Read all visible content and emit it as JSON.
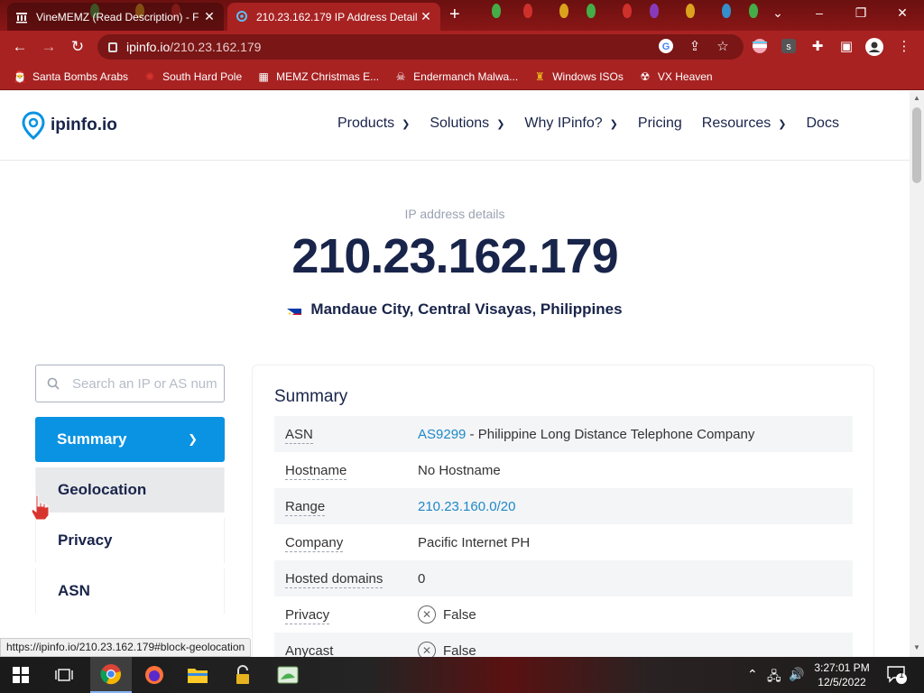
{
  "browser": {
    "tabs": [
      {
        "title": "VineMEMZ (Read Description) - F",
        "active": false
      },
      {
        "title": "210.23.162.179 IP Address Detail",
        "active": true
      }
    ],
    "url_domain": "ipinfo.io",
    "url_path": "/210.23.162.179",
    "bookmarks": [
      {
        "label": "Santa Bombs Arabs",
        "icon": "santa-icon"
      },
      {
        "label": "South Hard Pole",
        "icon": "flower-icon"
      },
      {
        "label": "MEMZ Christmas E...",
        "icon": "image-icon"
      },
      {
        "label": "Endermanch Malwa...",
        "icon": "skull-icon"
      },
      {
        "label": "Windows ISOs",
        "icon": "person-icon"
      },
      {
        "label": "VX Heaven",
        "icon": "bug-icon"
      }
    ],
    "status_url": "https://ipinfo.io/210.23.162.179#block-geolocation"
  },
  "site": {
    "logo": "ipinfo.io",
    "nav": [
      {
        "label": "Products",
        "dropdown": true
      },
      {
        "label": "Solutions",
        "dropdown": true
      },
      {
        "label": "Why IPinfo?",
        "dropdown": true
      },
      {
        "label": "Pricing",
        "dropdown": false
      },
      {
        "label": "Resources",
        "dropdown": true
      },
      {
        "label": "Docs",
        "dropdown": false
      }
    ]
  },
  "hero": {
    "subtitle": "IP address details",
    "ip": "210.23.162.179",
    "location": "Mandaue City, Central Visayas, Philippines"
  },
  "search": {
    "placeholder": "Search an IP or AS number"
  },
  "sidenav": [
    "Summary",
    "Geolocation",
    "Privacy",
    "ASN"
  ],
  "summary": {
    "title": "Summary",
    "rows": [
      {
        "key": "ASN",
        "link": "AS9299",
        "text": " - Philippine Long Distance Telephone Company"
      },
      {
        "key": "Hostname",
        "text": "No Hostname"
      },
      {
        "key": "Range",
        "link": "210.23.160.0/20"
      },
      {
        "key": "Company",
        "text": "Pacific Internet PH"
      },
      {
        "key": "Hosted domains",
        "text": "0"
      },
      {
        "key": "Privacy",
        "text": "False",
        "x": true
      },
      {
        "key": "Anycast",
        "text": "False",
        "x": true
      }
    ]
  },
  "taskbar": {
    "time": "3:27:01 PM",
    "date": "12/5/2022",
    "notifications": "1"
  }
}
